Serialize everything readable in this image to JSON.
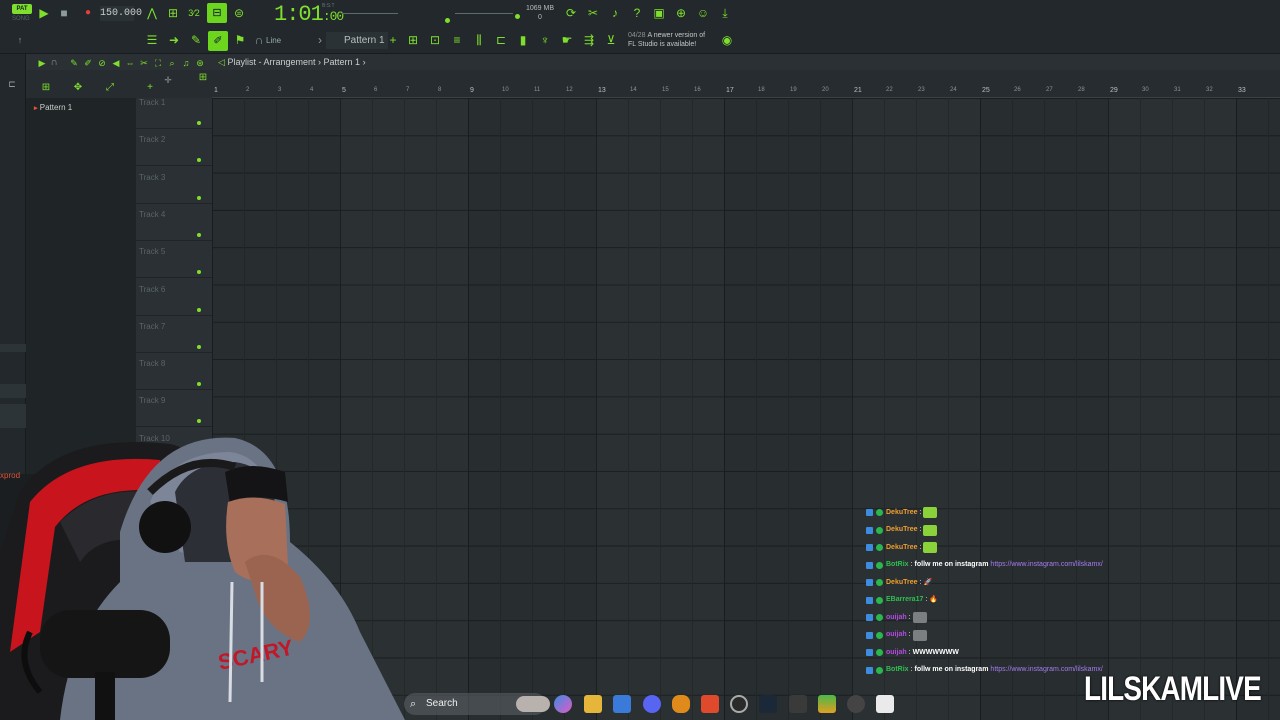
{
  "topbar": {
    "mode_badge": "PAT",
    "song_label": "SONG",
    "tempo": "150.000",
    "time": "1:01",
    "time_small": ":00",
    "time_sup": "B:S:T",
    "memory": "1069 MB",
    "memory_count": "0",
    "snap_mode": "Line",
    "pattern_selector": "Pattern 1",
    "news_date": "04/28",
    "news_text_1": "A newer version of",
    "news_text_2": "FL Studio is available!"
  },
  "playlist": {
    "breadcrumb": "Playlist - Arrangement",
    "breadcrumb_sep": "›",
    "current_pattern": "Pattern 1",
    "ruler": [
      "1",
      "2",
      "3",
      "4",
      "5",
      "6",
      "7",
      "8",
      "9",
      "10",
      "11",
      "12",
      "13",
      "14",
      "15",
      "16",
      "17",
      "18",
      "19",
      "20",
      "21",
      "22",
      "23",
      "24",
      "25",
      "26",
      "27",
      "28",
      "29",
      "30",
      "31",
      "32",
      "33"
    ],
    "tracks": [
      "Track 1",
      "Track 2",
      "Track 3",
      "Track 4",
      "Track 5",
      "Track 6",
      "Track 7",
      "Track 8",
      "Track 9",
      "Track 10"
    ]
  },
  "browser": {
    "patterns": [
      "Pattern 1"
    ]
  },
  "sidebar_tag": "xprod",
  "chat": [
    {
      "user": "DekuTree",
      "color": "#f0a030",
      "sep": ":",
      "text": "",
      "emote": "green",
      "link": ""
    },
    {
      "user": "DekuTree",
      "color": "#f0a030",
      "sep": ":",
      "text": "",
      "emote": "green",
      "link": ""
    },
    {
      "user": "DekuTree",
      "color": "#f0a030",
      "sep": ":",
      "text": "",
      "emote": "green",
      "link": ""
    },
    {
      "user": "BotRix",
      "color": "#2ec050",
      "sep": ":",
      "text": "follw me on instagram",
      "emote": "",
      "link": "https://www.instagram.com/lilskamx/"
    },
    {
      "user": "DekuTree",
      "color": "#f0a030",
      "sep": ":",
      "text": "🚀",
      "emote": "",
      "link": ""
    },
    {
      "user": "EBarrera17",
      "color": "#2ec050",
      "sep": ":",
      "text": "🔥",
      "emote": "",
      "link": ""
    },
    {
      "user": "ouijah",
      "color": "#b04ae0",
      "sep": ":",
      "text": "",
      "emote": "gray",
      "link": ""
    },
    {
      "user": "ouijah",
      "color": "#b04ae0",
      "sep": ":",
      "text": "",
      "emote": "gray",
      "link": ""
    },
    {
      "user": "ouijah",
      "color": "#b04ae0",
      "sep": ":",
      "text": "WWWWWWW",
      "emote": "",
      "link": ""
    },
    {
      "user": "BotRix",
      "color": "#2ec050",
      "sep": ":",
      "text": "follw me on instagram",
      "emote": "",
      "link": "https://www.instagram.com/lilskamx/"
    }
  ],
  "taskbar": {
    "search_placeholder": "Search"
  },
  "watermark": "LILSKAMLIVE",
  "colors": {
    "accent": "#7ee02c",
    "background": "#2b3033"
  }
}
